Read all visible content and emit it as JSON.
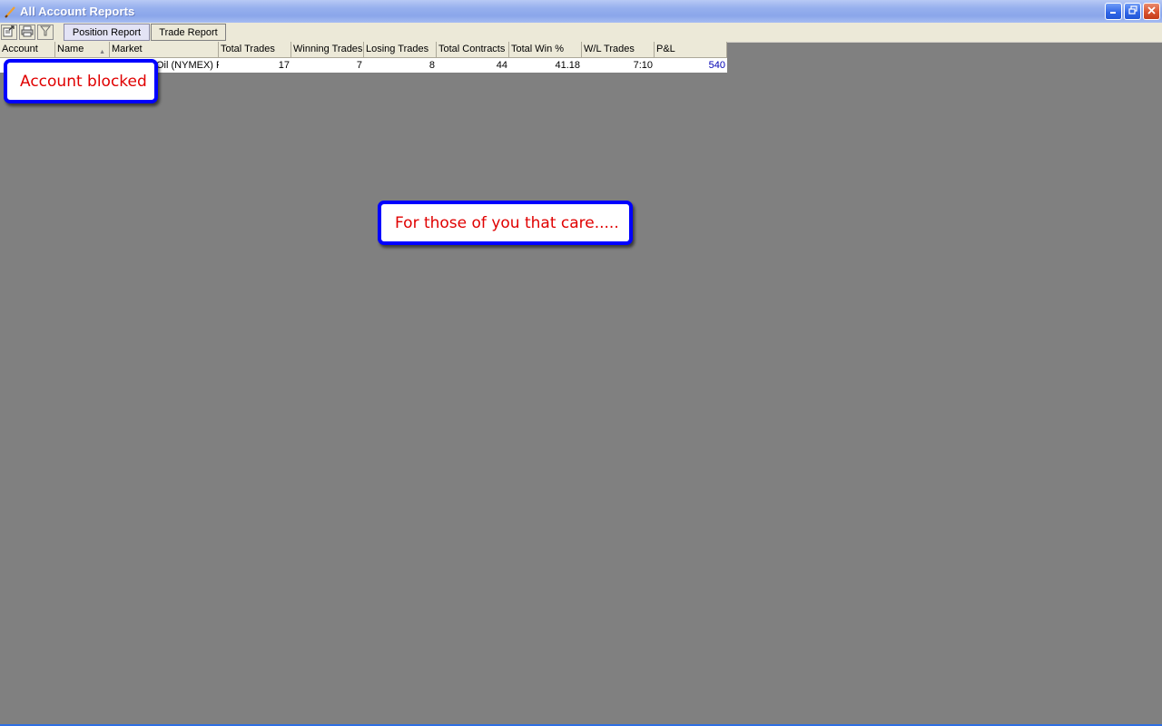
{
  "window": {
    "title": "All Account Reports",
    "icon": "pencil-icon",
    "controls": [
      "minimize-icon",
      "restore-icon",
      "close-icon"
    ]
  },
  "toolbar": {
    "icons": [
      "export-icon",
      "print-icon",
      "filter-icon"
    ],
    "tabs": [
      {
        "label": "Position Report",
        "active": true
      },
      {
        "label": "Trade Report",
        "active": false
      }
    ]
  },
  "table": {
    "columns": [
      "Account",
      "Name",
      "Market",
      "Total Trades",
      "Winning Trades",
      "Losing Trades",
      "Total Contracts",
      "Total Win %",
      "W/L Trades",
      "P&L"
    ],
    "rows": [
      {
        "account": "",
        "name": "",
        "market": "Oil (NYMEX) F",
        "total_trades": "17",
        "winning_trades": "7",
        "losing_trades": "8",
        "total_contracts": "44",
        "total_win_pct": "41.18",
        "wl_trades": "7:10",
        "pnl": "540"
      }
    ]
  },
  "annotations": {
    "account_blocked": "Account blocked",
    "for_those": "For those of you that care....."
  },
  "colors": {
    "background": "#808080",
    "callout_border": "#0000ff",
    "callout_text": "#e00000",
    "pnl_text": "#0000b4"
  }
}
